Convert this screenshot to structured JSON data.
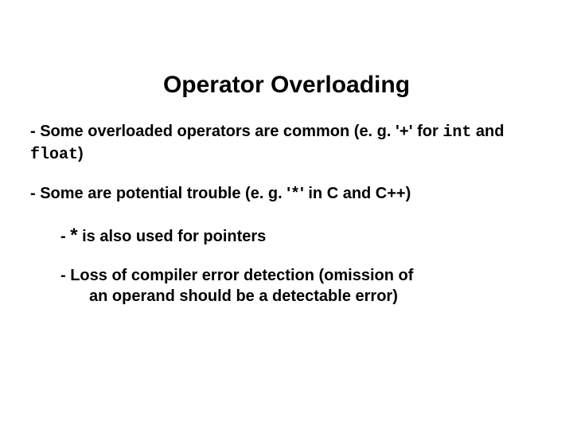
{
  "title": "Operator Overloading",
  "bullets": {
    "b1_part1": "- Some overloaded operators are common (e. g. '",
    "b1_mono1": "+",
    "b1_part2": "' for ",
    "b1_mono2": "int",
    "b1_part3": " and ",
    "b1_mono3": "float",
    "b1_part4": ")",
    "b2_part1": "- Some are potential trouble (e. g. '",
    "b2_mono1": "*",
    "b2_part2": "'  in C and C++)",
    "s1_part1": "-  ",
    "s1_star": "*",
    "s1_part2": " is also used for pointers",
    "s2_line1": "-  Loss of compiler error detection (omission of",
    "s2_line2": "an operand should be a detectable error)"
  }
}
